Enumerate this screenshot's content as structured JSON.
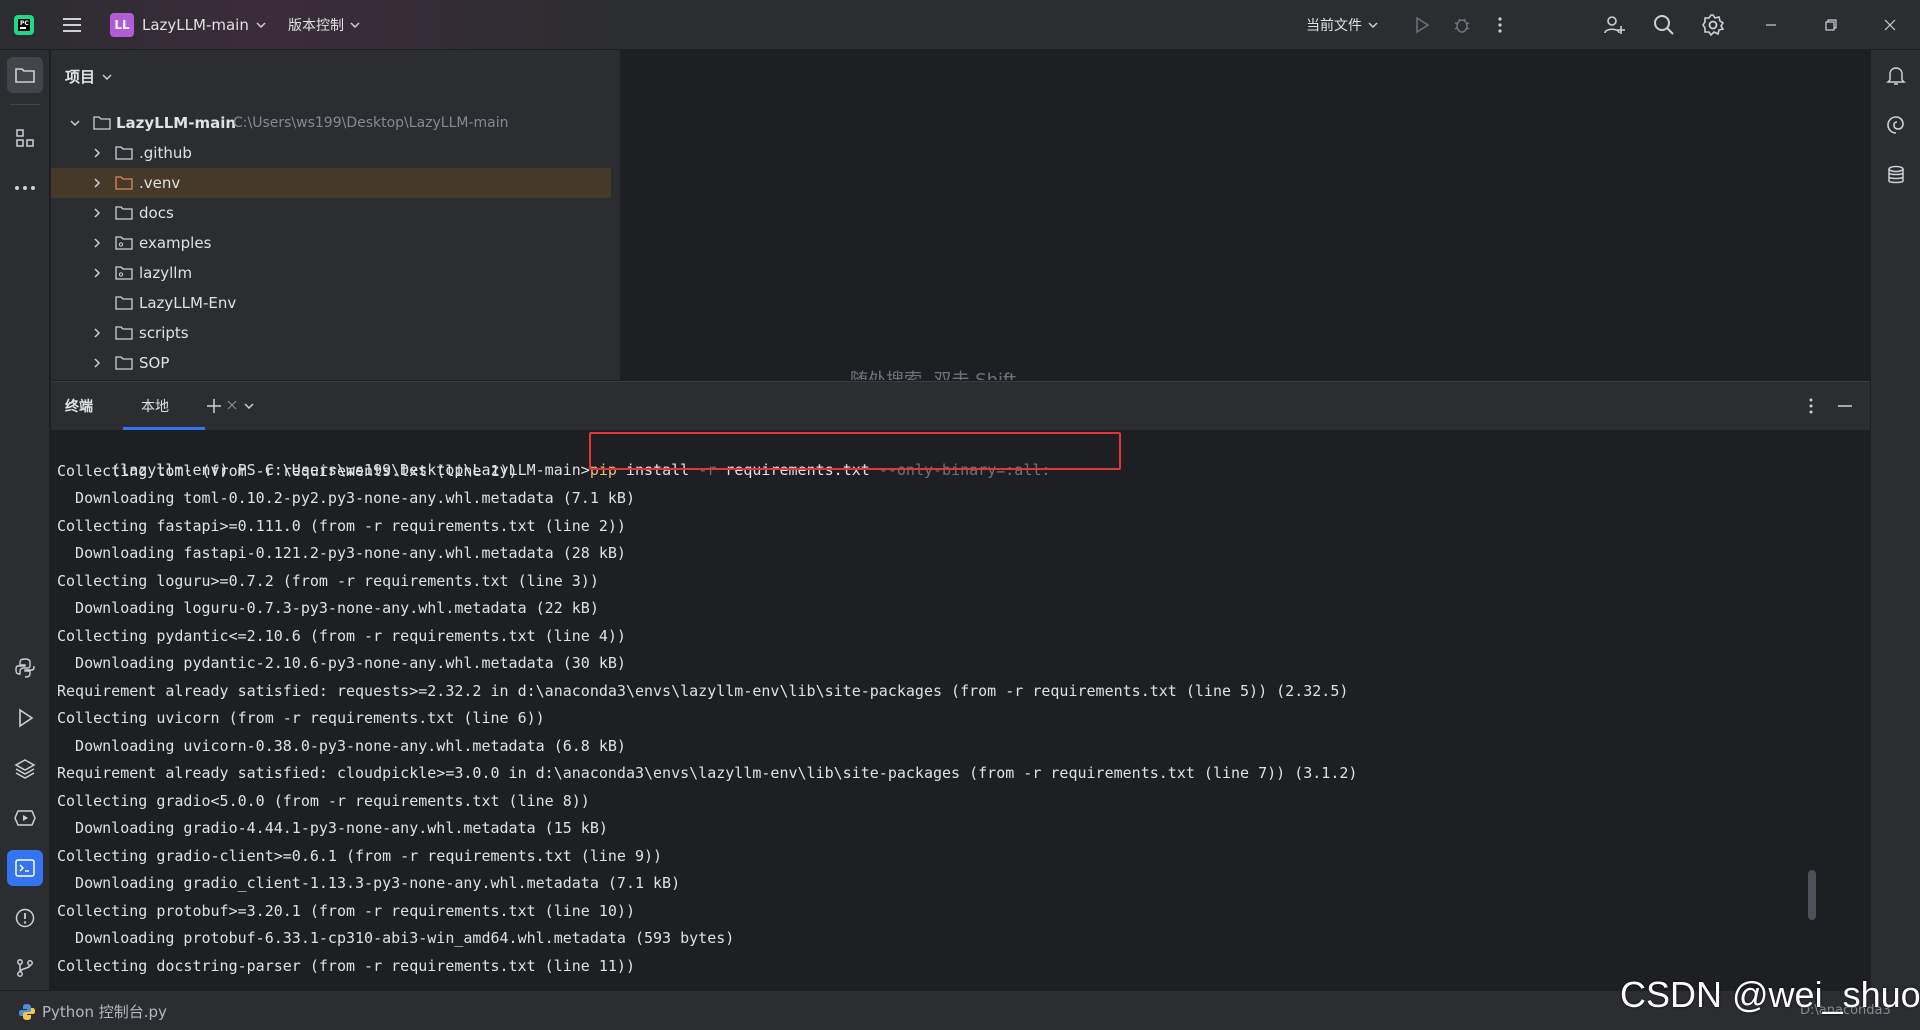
{
  "titlebar": {
    "project_initials": "LL",
    "project_name": "LazyLLM-main",
    "vcs_label": "版本控制",
    "run_config": "当前文件"
  },
  "project_panel": {
    "title": "项目",
    "root": {
      "name": "LazyLLM-main",
      "path": "C:\\Users\\ws199\\Desktop\\LazyLLM-main"
    },
    "items": [
      {
        "name": ".github"
      },
      {
        "name": ".venv"
      },
      {
        "name": "docs"
      },
      {
        "name": "examples"
      },
      {
        "name": "lazyllm"
      },
      {
        "name": "LazyLLM-Env"
      },
      {
        "name": "scripts"
      },
      {
        "name": "SOP"
      }
    ]
  },
  "editor": {
    "hint_text": "随处搜索  双击 Shift"
  },
  "terminal": {
    "tool_title": "终端",
    "tab_label": "本地",
    "prompt": "(lazyllm-env) PS C:\\Users\\ws199\\Desktop\\LazyLLM-main>",
    "cmd_pip": "pip",
    "cmd_install": "install",
    "cmd_flag_r": "-r",
    "cmd_file": "requirements.txt",
    "cmd_flag_only": "--only-binary=:all:",
    "lines": [
      "Collecting toml (from -r requirements.txt (line 1))",
      "  Downloading toml-0.10.2-py2.py3-none-any.whl.metadata (7.1 kB)",
      "Collecting fastapi>=0.111.0 (from -r requirements.txt (line 2))",
      "  Downloading fastapi-0.121.2-py3-none-any.whl.metadata (28 kB)",
      "Collecting loguru>=0.7.2 (from -r requirements.txt (line 3))",
      "  Downloading loguru-0.7.3-py3-none-any.whl.metadata (22 kB)",
      "Collecting pydantic<=2.10.6 (from -r requirements.txt (line 4))",
      "  Downloading pydantic-2.10.6-py3-none-any.whl.metadata (30 kB)",
      "Requirement already satisfied: requests>=2.32.2 in d:\\anaconda3\\envs\\lazyllm-env\\lib\\site-packages (from -r requirements.txt (line 5)) (2.32.5)",
      "Collecting uvicorn (from -r requirements.txt (line 6))",
      "  Downloading uvicorn-0.38.0-py3-none-any.whl.metadata (6.8 kB)",
      "Requirement already satisfied: cloudpickle>=3.0.0 in d:\\anaconda3\\envs\\lazyllm-env\\lib\\site-packages (from -r requirements.txt (line 7)) (3.1.2)",
      "Collecting gradio<5.0.0 (from -r requirements.txt (line 8))",
      "  Downloading gradio-4.44.1-py3-none-any.whl.metadata (15 kB)",
      "Collecting gradio-client>=0.6.1 (from -r requirements.txt (line 9))",
      "  Downloading gradio_client-1.13.3-py3-none-any.whl.metadata (7.1 kB)",
      "Collecting protobuf>=3.20.1 (from -r requirements.txt (line 10))",
      "  Downloading protobuf-6.33.1-cp310-abi3-win_amd64.whl.metadata (593 bytes)",
      "Collecting docstring-parser (from -r requirements.txt (line 11))"
    ]
  },
  "statusbar": {
    "interpreter": "Python 控制台.py",
    "right_text": "D:\\anaconda3"
  },
  "watermark": "CSDN @wei_shuo",
  "colors": {
    "accent": "#3574f0",
    "highlight_box": "#e0353a",
    "cmd_keyword": "#e6c07b",
    "cmd_flag": "#6f737a"
  }
}
